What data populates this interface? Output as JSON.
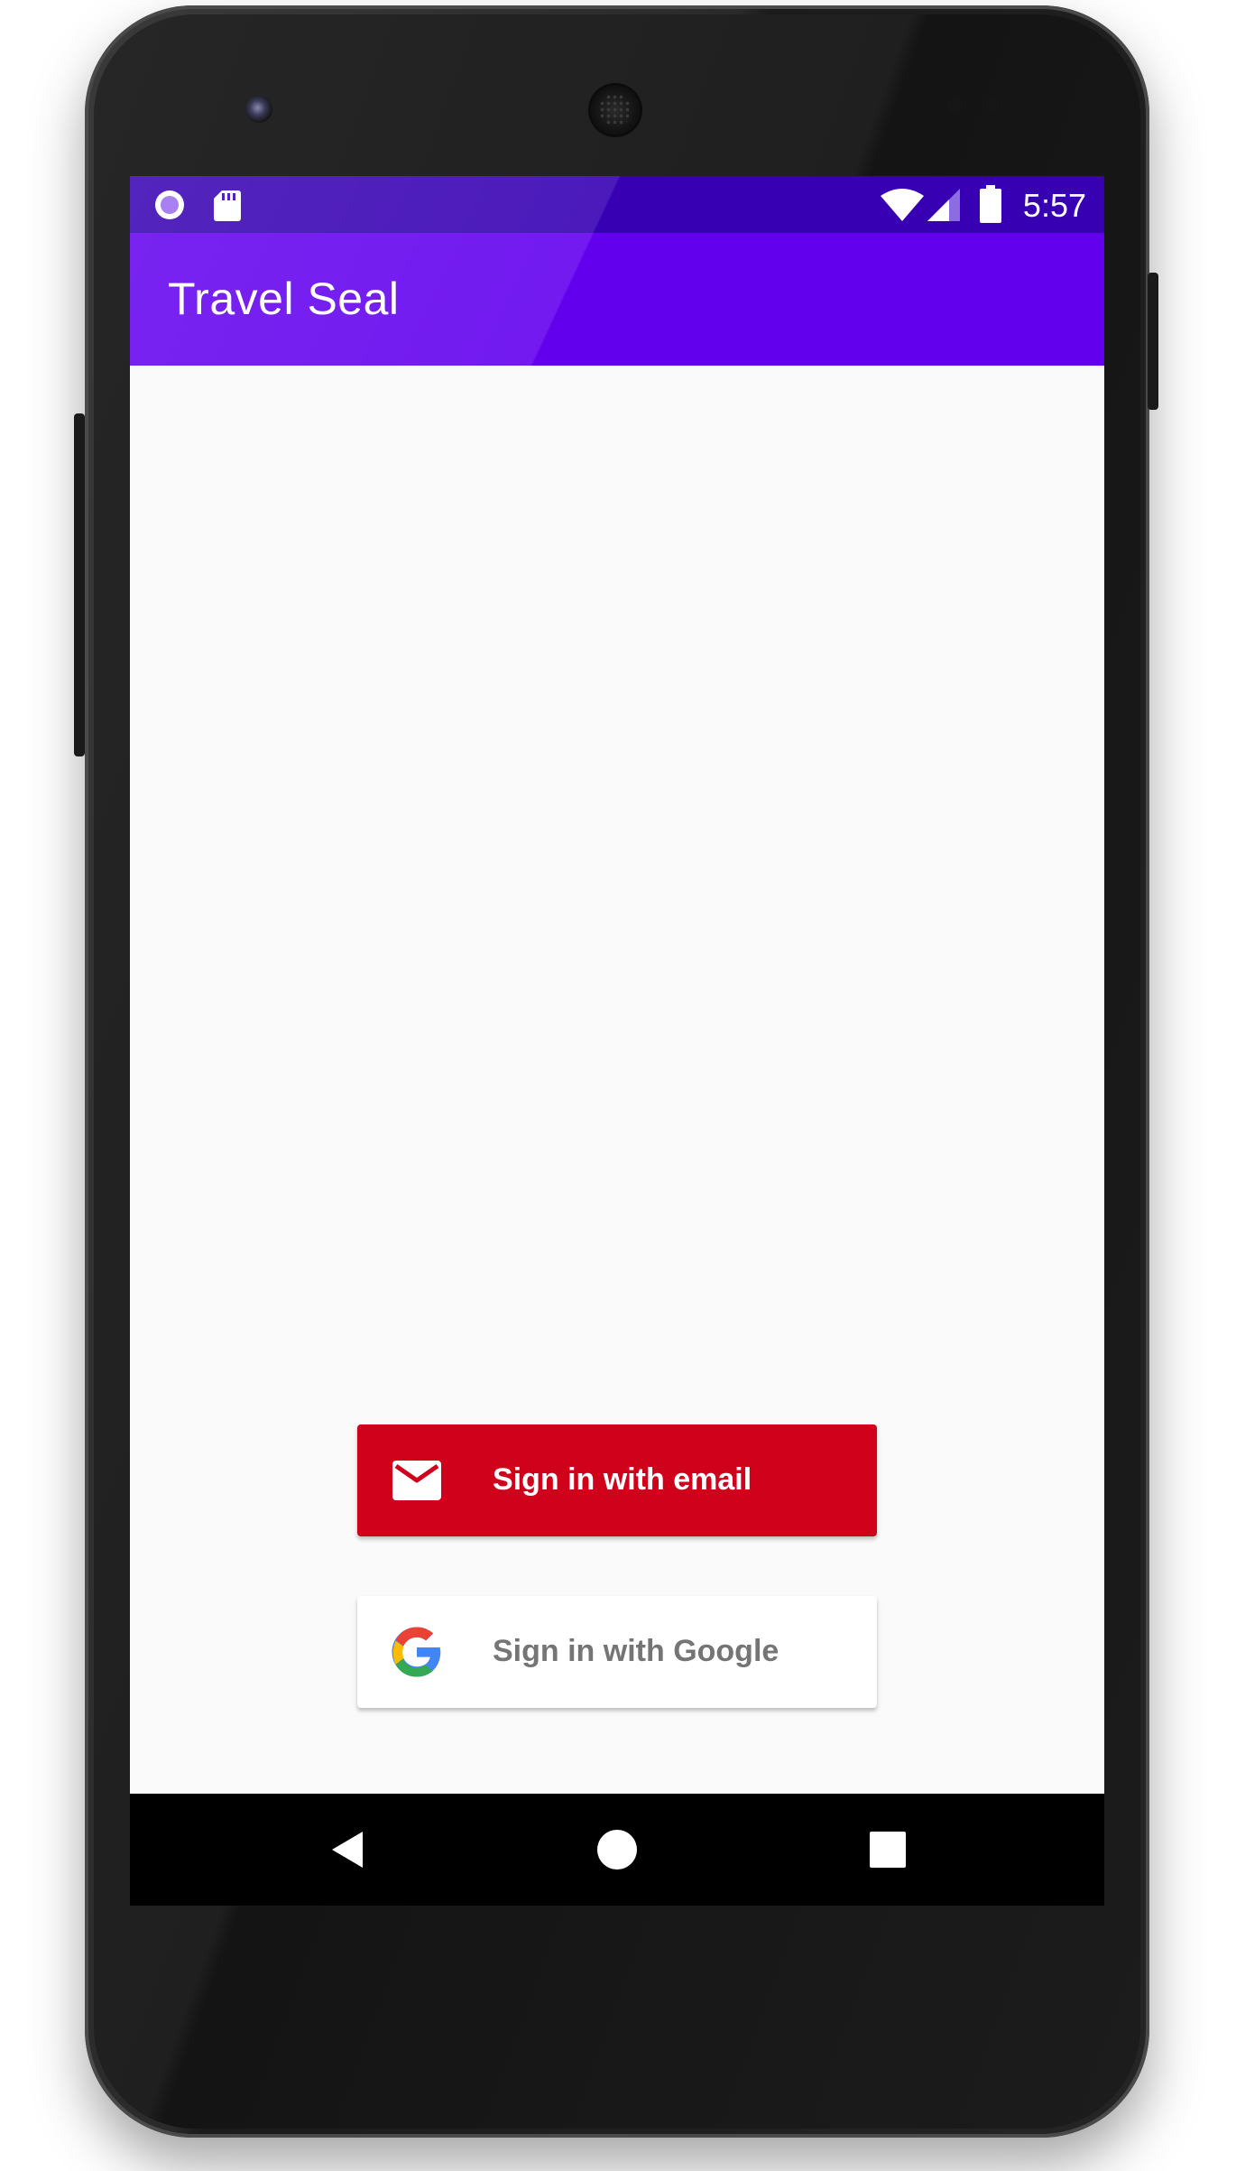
{
  "status_bar": {
    "time": "5:57",
    "left_icons": [
      "notification-circle-icon",
      "sd-card-icon"
    ],
    "right_icons": [
      "wifi-icon",
      "cellular-signal-icon",
      "battery-icon"
    ],
    "color": "#3700b3"
  },
  "app_bar": {
    "title": "Travel Seal",
    "color": "#6200ee"
  },
  "sign_in": {
    "email_button": {
      "label": "Sign in with email",
      "icon": "mail-icon",
      "color": "#d0021b"
    },
    "google_button": {
      "label": "Sign in with Google",
      "icon": "google-logo-icon",
      "color": "#ffffff"
    }
  },
  "nav_bar": {
    "buttons": [
      "back-icon",
      "home-icon",
      "recents-icon"
    ]
  }
}
